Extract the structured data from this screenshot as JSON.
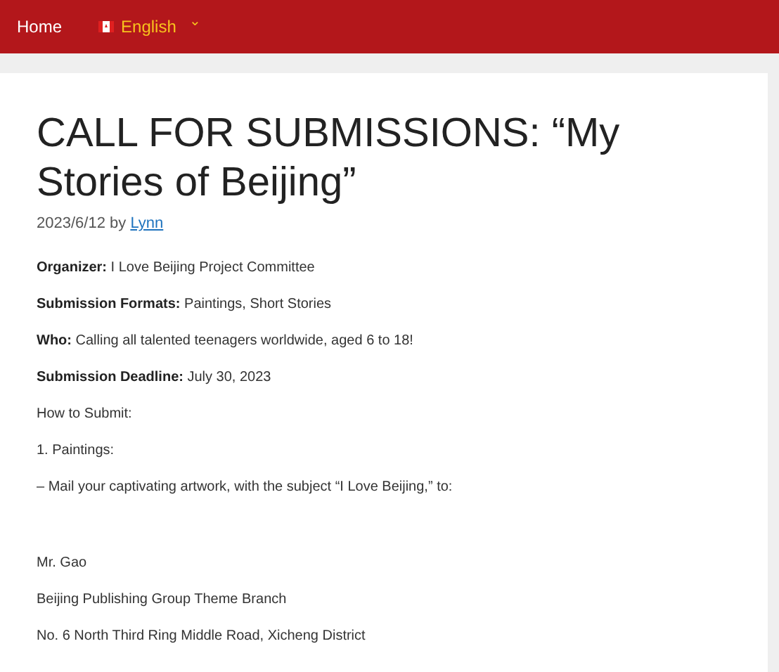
{
  "nav": {
    "home": "Home",
    "language": {
      "label": "English",
      "caret": "⌄"
    }
  },
  "article": {
    "title": "CALL FOR SUBMISSIONS: “My Stories of Beijing”",
    "date": "2023/6/12",
    "by": "by",
    "author": "Lynn",
    "paragraphs": [
      {
        "label": "Organizer:",
        "text": "I Love Beijing Project Committee"
      },
      {
        "label": "Submission Formats:",
        "text": "Paintings, Short Stories"
      },
      {
        "label": "Who:",
        "text": "Calling all talented teenagers worldwide, aged 6 to 18!"
      },
      {
        "label": "Submission Deadline:",
        "text": "July 30, 2023"
      },
      {
        "text": "How to Submit:"
      },
      {
        "text": "1. Paintings:"
      },
      {
        "text": "– Mail your captivating artwork, with the subject “I Love Beijing,” to:"
      }
    ],
    "address": [
      "Mr. Gao",
      "Beijing Publishing Group Theme Branch",
      "No. 6 North Third Ring Middle Road, Xicheng District"
    ]
  }
}
